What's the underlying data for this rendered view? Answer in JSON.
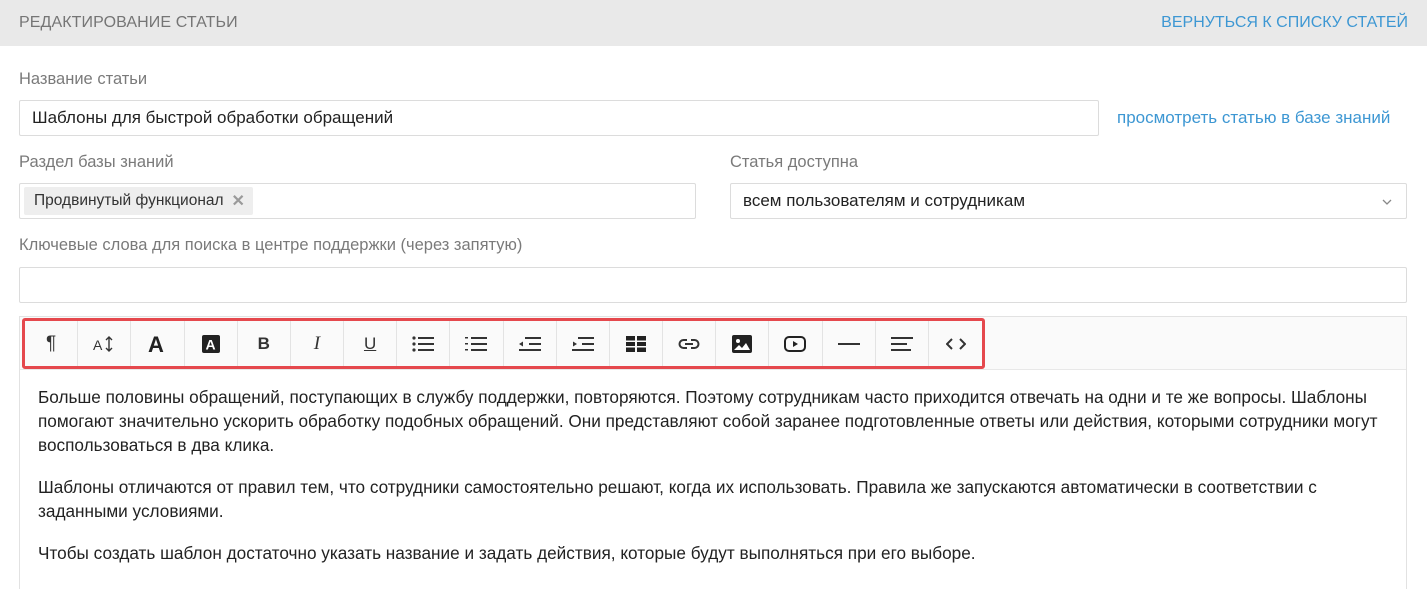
{
  "header": {
    "title": "РЕДАКТИРОВАНИЕ СТАТЬИ",
    "back_link": "ВЕРНУТЬСЯ К СПИСКУ СТАТЕЙ"
  },
  "form": {
    "title_label": "Название статьи",
    "title_value": "Шаблоны для быстрой обработки обращений",
    "view_link": "просмотреть статью в базе знаний",
    "section_label": "Раздел базы знаний",
    "section_tag": "Продвинутый функционал",
    "access_label": "Статья доступна",
    "access_value": "всем пользователям и сотрудникам",
    "keywords_label": "Ключевые слова для поиска в центре поддержки (через запятую)",
    "keywords_value": ""
  },
  "toolbar": {
    "highlight_color": "#e5484d",
    "buttons": [
      {
        "name": "paragraph-icon"
      },
      {
        "name": "font-size-icon"
      },
      {
        "name": "font-color-icon"
      },
      {
        "name": "background-color-icon"
      },
      {
        "name": "bold-icon",
        "text": "B"
      },
      {
        "name": "italic-icon",
        "text": "I"
      },
      {
        "name": "underline-icon",
        "text": "U"
      },
      {
        "name": "bullet-list-icon"
      },
      {
        "name": "numbered-list-icon"
      },
      {
        "name": "outdent-icon"
      },
      {
        "name": "indent-icon"
      },
      {
        "name": "table-icon"
      },
      {
        "name": "link-icon"
      },
      {
        "name": "image-icon"
      },
      {
        "name": "video-icon"
      },
      {
        "name": "horizontal-rule-icon"
      },
      {
        "name": "align-icon"
      },
      {
        "name": "code-icon"
      }
    ]
  },
  "content": {
    "paragraphs": [
      "Больше половины обращений, поступающих в службу поддержки, повторяются. Поэтому сотрудникам часто приходится отвечать на одни и те же вопросы. Шаблоны помогают значительно ускорить обработку подобных обращений. Они представляют собой заранее подготовленные ответы или действия, которыми сотрудники могут воспользоваться в два клика.",
      "Шаблоны отличаются от правил тем, что сотрудники самостоятельно решают, когда их использовать. Правила же запускаются автоматически в соответствии с заданными условиями.",
      "Чтобы создать шаблон достаточно указать название и задать действия, которые будут выполняться при его выборе."
    ]
  }
}
